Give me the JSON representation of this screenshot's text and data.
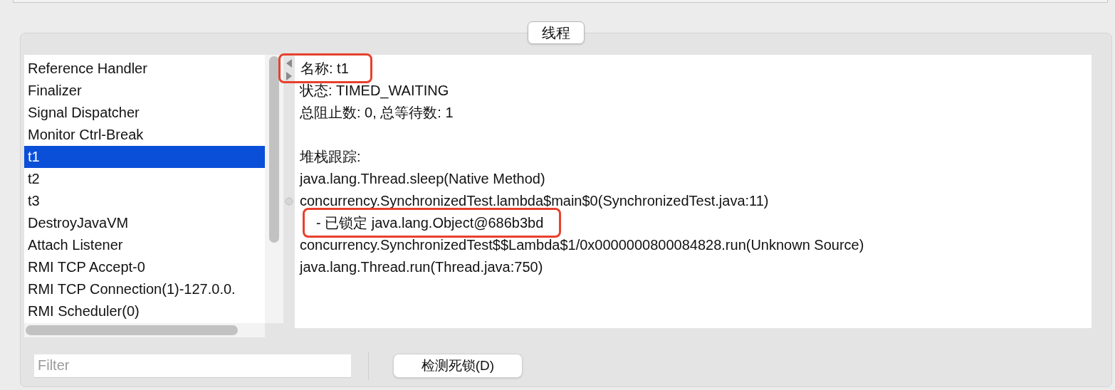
{
  "tab": {
    "label": "线程",
    "selected": true
  },
  "threads": [
    {
      "name": "Reference Handler",
      "selected": false
    },
    {
      "name": "Finalizer",
      "selected": false
    },
    {
      "name": "Signal Dispatcher",
      "selected": false
    },
    {
      "name": "Monitor Ctrl-Break",
      "selected": false
    },
    {
      "name": "t1",
      "selected": true
    },
    {
      "name": "t2",
      "selected": false
    },
    {
      "name": "t3",
      "selected": false
    },
    {
      "name": "DestroyJavaVM",
      "selected": false
    },
    {
      "name": "Attach Listener",
      "selected": false
    },
    {
      "name": "RMI TCP Accept-0",
      "selected": false
    },
    {
      "name": "RMI TCP Connection(1)-127.0.0.",
      "selected": false
    },
    {
      "name": "RMI Scheduler(0)",
      "selected": false
    }
  ],
  "detail": {
    "lines": [
      {
        "kind": "text",
        "text": "名称: t1",
        "highlighted": true
      },
      {
        "kind": "text",
        "text": "状态: TIMED_WAITING",
        "highlighted": false
      },
      {
        "kind": "text",
        "text": "总阻止数: 0, 总等待数: 1",
        "highlighted": false
      },
      {
        "kind": "blank"
      },
      {
        "kind": "text",
        "text": "堆栈跟踪:",
        "highlighted": false
      },
      {
        "kind": "text",
        "text": "java.lang.Thread.sleep(Native Method)",
        "highlighted": false
      },
      {
        "kind": "text",
        "text": "concurrency.SynchronizedTest.lambda$main$0(SynchronizedTest.java:11)",
        "highlighted": false
      },
      {
        "kind": "indented",
        "text": "- 已锁定 java.lang.Object@686b3bd",
        "highlighted": true
      },
      {
        "kind": "text",
        "text": "concurrency.SynchronizedTest$$Lambda$1/0x0000000800084828.run(Unknown Source)",
        "highlighted": false
      },
      {
        "kind": "text",
        "text": "java.lang.Thread.run(Thread.java:750)",
        "highlighted": false
      }
    ]
  },
  "filter": {
    "placeholder": "Filter"
  },
  "detect_button": {
    "label": "检测死锁(D)"
  }
}
